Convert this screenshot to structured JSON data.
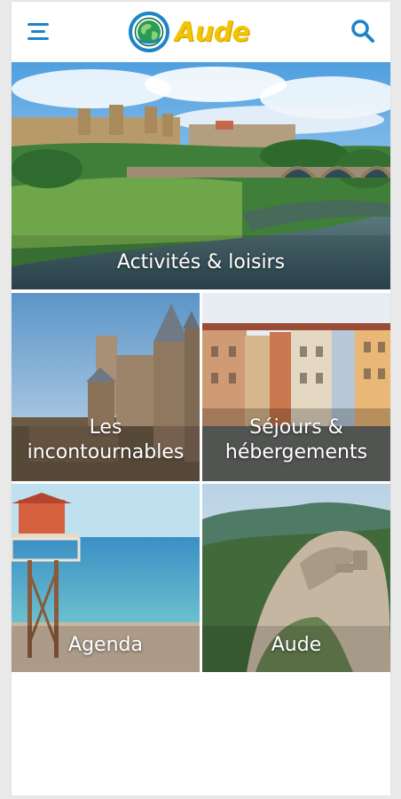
{
  "header": {
    "menu_icon": "hamburger-menu-icon",
    "logo_text": "Aude",
    "logo_icon": "globe-logo-icon",
    "search_icon": "search-icon"
  },
  "tiles": [
    {
      "label": "Activités & loisirs",
      "image": "carcassonne-river-bridge-photo"
    },
    {
      "label_line1": "Les",
      "label_line2": "incontournables",
      "image": "castle-towers-photo"
    },
    {
      "label_line1": "Séjours &",
      "label_line2": "hébergements",
      "image": "colorful-town-houses-photo"
    },
    {
      "label": "Agenda",
      "image": "beach-lifeguard-tower-photo"
    },
    {
      "label": "Aude",
      "image": "mountain-castle-ruins-photo"
    }
  ],
  "colors": {
    "accent": "#1c84c6",
    "logo_yellow": "#f5c400",
    "background": "#ffffff"
  }
}
